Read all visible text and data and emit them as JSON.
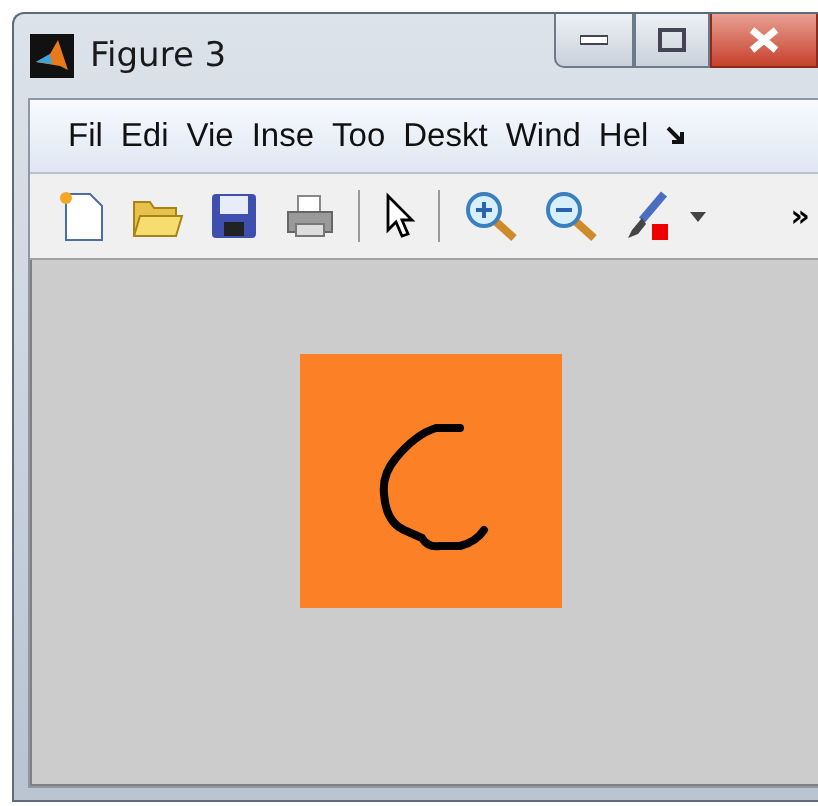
{
  "window": {
    "title": "Figure 3"
  },
  "menu": [
    {
      "label": "Fil"
    },
    {
      "label": "Edi"
    },
    {
      "label": "Vie"
    },
    {
      "label": "Inse"
    },
    {
      "label": "Too"
    },
    {
      "label": "Deskt"
    },
    {
      "label": "Wind"
    },
    {
      "label": "Hel"
    }
  ],
  "toolbar": {
    "overflow": "»"
  }
}
